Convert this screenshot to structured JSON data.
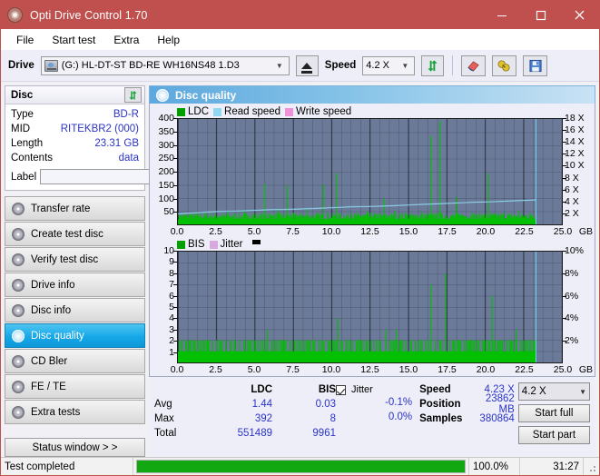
{
  "window": {
    "title": "Opti Drive Control 1.70",
    "icon": "disc-icon",
    "minimize": "minimize-icon",
    "maximize": "maximize-icon",
    "close": "close-icon"
  },
  "menu": [
    {
      "label": "File"
    },
    {
      "label": "Start test"
    },
    {
      "label": "Extra"
    },
    {
      "label": "Help"
    }
  ],
  "toolbar": {
    "drive_label": "Drive",
    "drive_value": "(G:)  HL-DT-ST BD-RE  WH16NS48 1.D3",
    "eject_icon": "eject-icon",
    "speed_label": "Speed",
    "speed_value": "4.2 X",
    "refresh_icon": "refresh-icon",
    "eraser_icon": "eraser-icon",
    "plug_icon": "plug-icon",
    "save_icon": "save-icon"
  },
  "disc": {
    "title": "Disc",
    "refresh_icon": "refresh-icon",
    "rows": [
      {
        "key": "Type",
        "value": "BD-R"
      },
      {
        "key": "MID",
        "value": "RITEKBR2 (000)"
      },
      {
        "key": "Length",
        "value": "23.31 GB"
      },
      {
        "key": "Contents",
        "value": "data"
      }
    ],
    "label_key": "Label",
    "label_value": "",
    "label_placeholder": "",
    "disc_button_icon": "disc-icon"
  },
  "sidebar": {
    "items": [
      {
        "label": "Transfer rate",
        "active": false
      },
      {
        "label": "Create test disc",
        "active": false
      },
      {
        "label": "Verify test disc",
        "active": false
      },
      {
        "label": "Drive info",
        "active": false
      },
      {
        "label": "Disc info",
        "active": false
      },
      {
        "label": "Disc quality",
        "active": true
      },
      {
        "label": "CD Bler",
        "active": false
      },
      {
        "label": "FE / TE",
        "active": false
      },
      {
        "label": "Extra tests",
        "active": false
      }
    ],
    "status_window": "Status window > >"
  },
  "panel": {
    "title": "Disc quality",
    "icon": "disc-icon"
  },
  "chart_data": [
    {
      "type": "line",
      "title": "LDC / Read speed",
      "xlabel": "GB",
      "ylabel": "LDC",
      "xlim": [
        0,
        25
      ],
      "ylim": [
        0,
        400
      ],
      "y2lim": [
        0,
        18
      ],
      "y2label": "X",
      "grid": true,
      "legend_position": "top-left",
      "legend": [
        {
          "name": "LDC",
          "color": "#00a000"
        },
        {
          "name": "Read speed",
          "color": "#90d8f0"
        },
        {
          "name": "Write speed",
          "color": "#f090d8"
        }
      ],
      "xticks": [
        "0.0",
        "2.5",
        "5.0",
        "7.5",
        "10.0",
        "12.5",
        "15.0",
        "17.5",
        "20.0",
        "22.5",
        "25.0"
      ],
      "yticks": [
        50,
        100,
        150,
        200,
        250,
        300,
        350,
        400
      ],
      "y2ticks": [
        "2 X",
        "4 X",
        "6 X",
        "8 X",
        "10 X",
        "12 X",
        "14 X",
        "16 X",
        "18 X"
      ],
      "test_end_x": 23.31,
      "series": [
        {
          "name": "Read speed",
          "color": "#90d8f0",
          "axis": "y2",
          "x": [
            0.0,
            0.6,
            1.2,
            1.9,
            2.6,
            3.3,
            4.1,
            5.0,
            5.9,
            6.8,
            7.7,
            8.6,
            9.5,
            10.4,
            11.3,
            12.2,
            13.1,
            14.0,
            14.9,
            15.8,
            16.7,
            17.6,
            18.5,
            19.4,
            20.3,
            21.2,
            22.1,
            23.0,
            23.31
          ],
          "values": [
            1.8,
            1.9,
            2.0,
            2.1,
            2.2,
            2.25,
            2.3,
            2.4,
            2.5,
            2.55,
            2.6,
            2.7,
            2.8,
            2.9,
            3.0,
            3.05,
            3.1,
            3.2,
            3.3,
            3.4,
            3.5,
            3.6,
            3.7,
            3.8,
            3.85,
            3.95,
            4.05,
            4.15,
            4.2
          ]
        },
        {
          "name": "LDC",
          "color": "#00c000",
          "axis": "y",
          "baseline": 18,
          "spikes": [
            [
              0.15,
              30
            ],
            [
              0.45,
              24
            ],
            [
              0.8,
              38
            ],
            [
              1.15,
              26
            ],
            [
              1.5,
              30
            ],
            [
              1.85,
              45
            ],
            [
              2.2,
              28
            ],
            [
              2.55,
              34
            ],
            [
              2.9,
              26
            ],
            [
              3.25,
              48
            ],
            [
              3.6,
              30
            ],
            [
              3.95,
              28
            ],
            [
              4.3,
              55
            ],
            [
              4.6,
              32
            ],
            [
              4.95,
              40
            ],
            [
              5.3,
              30
            ],
            [
              5.65,
              153
            ],
            [
              5.9,
              44
            ],
            [
              6.2,
              35
            ],
            [
              6.5,
              60
            ],
            [
              6.85,
              30
            ],
            [
              7.1,
              148
            ],
            [
              7.35,
              38
            ],
            [
              7.7,
              30
            ],
            [
              8.05,
              34
            ],
            [
              8.4,
              58
            ],
            [
              8.75,
              28
            ],
            [
              9.1,
              30
            ],
            [
              9.45,
              152
            ],
            [
              9.75,
              44
            ],
            [
              10.05,
              30
            ],
            [
              10.3,
              193
            ],
            [
              10.6,
              36
            ],
            [
              10.95,
              30
            ],
            [
              11.3,
              42
            ],
            [
              11.65,
              28
            ],
            [
              12.0,
              35
            ],
            [
              12.35,
              50
            ],
            [
              12.7,
              30
            ],
            [
              13.05,
              38
            ],
            [
              13.4,
              98
            ],
            [
              13.75,
              34
            ],
            [
              14.1,
              52
            ],
            [
              14.45,
              30
            ],
            [
              14.8,
              44
            ],
            [
              15.15,
              30
            ],
            [
              15.5,
              36
            ],
            [
              15.85,
              48
            ],
            [
              16.2,
              32
            ],
            [
              16.45,
              336
            ],
            [
              16.8,
              40
            ],
            [
              17.05,
              392
            ],
            [
              17.4,
              34
            ],
            [
              17.75,
              30
            ],
            [
              18.1,
              104
            ],
            [
              18.45,
              36
            ],
            [
              18.8,
              30
            ],
            [
              19.15,
              42
            ],
            [
              19.5,
              30
            ],
            [
              19.85,
              34
            ],
            [
              20.2,
              193
            ],
            [
              20.5,
              38
            ],
            [
              20.85,
              30
            ],
            [
              21.2,
              46
            ],
            [
              21.55,
              30
            ],
            [
              21.9,
              36
            ],
            [
              22.2,
              52
            ],
            [
              22.55,
              30
            ],
            [
              22.9,
              40
            ],
            [
              23.15,
              34
            ]
          ]
        }
      ]
    },
    {
      "type": "line",
      "title": "BIS / Jitter",
      "xlabel": "GB",
      "ylabel": "BIS",
      "xlim": [
        0,
        25
      ],
      "ylim": [
        0,
        10
      ],
      "y2lim": [
        0,
        10
      ],
      "y2label": "%",
      "grid": true,
      "legend_position": "top-left",
      "legend": [
        {
          "name": "BIS",
          "color": "#00a000"
        },
        {
          "name": "Jitter",
          "color": "#d8a8e0"
        }
      ],
      "xticks": [
        "0.0",
        "2.5",
        "5.0",
        "7.5",
        "10.0",
        "12.5",
        "15.0",
        "17.5",
        "20.0",
        "22.5",
        "25.0"
      ],
      "yticks": [
        1,
        2,
        3,
        4,
        5,
        6,
        7,
        8,
        9,
        10
      ],
      "y2ticks": [
        "2%",
        "4%",
        "6%",
        "8%",
        "10%"
      ],
      "test_end_x": 23.31,
      "series": [
        {
          "name": "BIS",
          "color": "#00c000",
          "axis": "y",
          "baseline": 1,
          "spikes": [
            [
              0.2,
              2
            ],
            [
              0.5,
              2
            ],
            [
              0.75,
              2
            ],
            [
              1.0,
              2
            ],
            [
              1.3,
              2
            ],
            [
              1.6,
              2
            ],
            [
              1.95,
              2
            ],
            [
              2.25,
              2
            ],
            [
              2.5,
              2
            ],
            [
              2.8,
              2
            ],
            [
              3.1,
              2
            ],
            [
              3.45,
              2
            ],
            [
              3.7,
              2
            ],
            [
              4.0,
              2
            ],
            [
              4.3,
              2
            ],
            [
              4.6,
              2
            ],
            [
              4.95,
              2
            ],
            [
              5.2,
              2
            ],
            [
              5.5,
              2
            ],
            [
              5.8,
              3
            ],
            [
              6.1,
              2
            ],
            [
              6.4,
              2
            ],
            [
              6.75,
              2
            ],
            [
              7.0,
              2
            ],
            [
              7.3,
              2
            ],
            [
              7.6,
              2
            ],
            [
              7.95,
              2
            ],
            [
              8.25,
              2
            ],
            [
              8.55,
              2
            ],
            [
              8.9,
              2
            ],
            [
              9.2,
              2
            ],
            [
              9.5,
              2
            ],
            [
              9.85,
              2
            ],
            [
              10.1,
              2
            ],
            [
              10.4,
              4
            ],
            [
              10.7,
              2
            ],
            [
              11.0,
              2
            ],
            [
              11.35,
              2
            ],
            [
              11.6,
              2
            ],
            [
              11.95,
              2
            ],
            [
              12.25,
              2
            ],
            [
              12.6,
              2
            ],
            [
              12.9,
              2
            ],
            [
              13.2,
              2
            ],
            [
              13.55,
              3
            ],
            [
              13.85,
              2
            ],
            [
              14.2,
              3
            ],
            [
              14.5,
              2
            ],
            [
              14.85,
              2
            ],
            [
              15.15,
              2
            ],
            [
              15.45,
              2
            ],
            [
              15.8,
              2
            ],
            [
              16.1,
              2
            ],
            [
              16.45,
              7
            ],
            [
              16.75,
              2
            ],
            [
              17.05,
              2
            ],
            [
              17.4,
              8
            ],
            [
              17.7,
              2
            ],
            [
              18.0,
              2
            ],
            [
              18.35,
              2
            ],
            [
              18.65,
              2
            ],
            [
              19.0,
              2
            ],
            [
              19.3,
              2
            ],
            [
              19.6,
              2
            ],
            [
              19.95,
              2
            ],
            [
              20.25,
              2
            ],
            [
              20.45,
              6
            ],
            [
              20.8,
              2
            ],
            [
              21.1,
              2
            ],
            [
              21.4,
              2
            ],
            [
              21.7,
              2
            ],
            [
              22.0,
              3
            ],
            [
              22.3,
              2
            ],
            [
              22.6,
              2
            ],
            [
              22.9,
              2
            ],
            [
              23.15,
              2
            ]
          ]
        }
      ]
    }
  ],
  "stats": {
    "headers": {
      "row": "",
      "ldc": "LDC",
      "bis": "BIS"
    },
    "rows": [
      {
        "label": "Avg",
        "ldc": "1.44",
        "bis": "0.03",
        "jitter": "-0.1%"
      },
      {
        "label": "Max",
        "ldc": "392",
        "bis": "8",
        "jitter": "0.0%"
      },
      {
        "label": "Total",
        "ldc": "551489",
        "bis": "9961",
        "jitter": ""
      }
    ],
    "jitter_label": "Jitter",
    "jitter_checked": true,
    "right": [
      {
        "key": "Speed",
        "value": "4.23 X"
      },
      {
        "key": "Position",
        "value": "23862 MB"
      },
      {
        "key": "Samples",
        "value": "380864"
      }
    ],
    "speed_select": "4.2 X",
    "start_full": "Start full",
    "start_part": "Start part"
  },
  "statusbar": {
    "message": "Test completed",
    "progress_percent": 100,
    "percent_text": "100.0%",
    "time": "31:27"
  },
  "colors": {
    "accent": "#c0504d",
    "plot_bg": "#6b7a99",
    "ldc_green": "#00c000",
    "read_speed": "#90d8f0",
    "value_blue": "#2b34c7",
    "progress_green": "#11a811"
  }
}
